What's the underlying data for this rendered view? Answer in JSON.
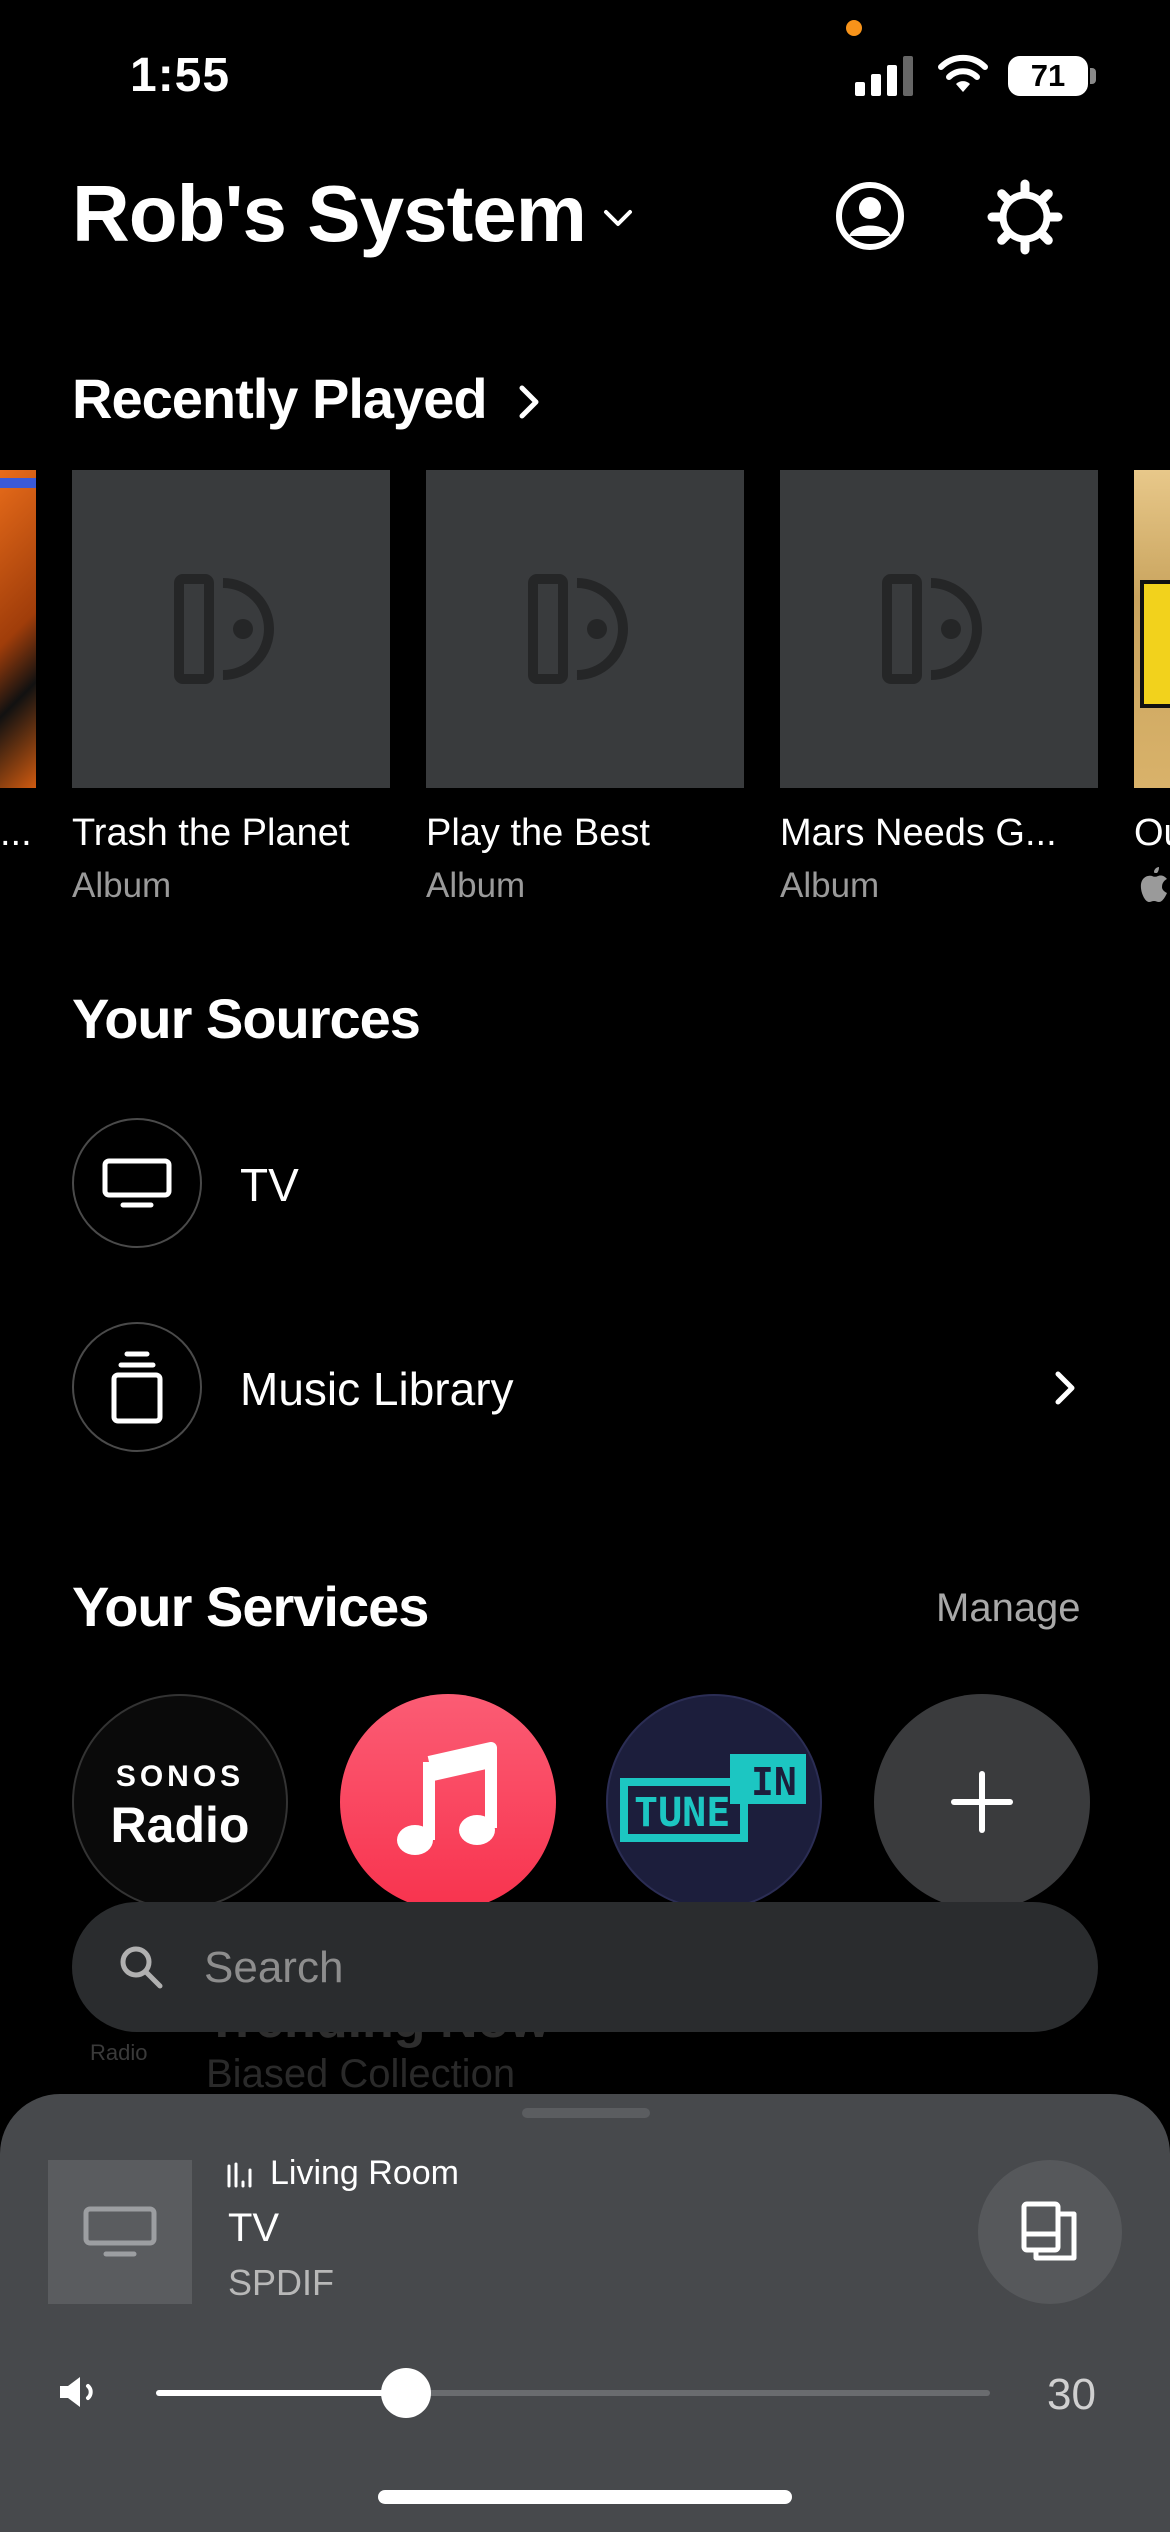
{
  "status_bar": {
    "time": "1:55",
    "battery": "71"
  },
  "header": {
    "title": "Rob's System"
  },
  "recently_played": {
    "title": "Recently Played",
    "left_partial_title": "...",
    "items": [
      {
        "title": "Trash the Planet",
        "subtitle": "Album"
      },
      {
        "title": "Play the Best",
        "subtitle": "Album"
      },
      {
        "title": "Mars Needs G...",
        "subtitle": "Album"
      }
    ],
    "right_partial_title": "Ou"
  },
  "sources": {
    "title": "Your Sources",
    "items": [
      {
        "label": "TV",
        "icon": "tv-icon"
      },
      {
        "label": "Music Library",
        "icon": "music-library-icon"
      }
    ]
  },
  "services": {
    "title": "Your Services",
    "manage_label": "Manage",
    "sonos_radio": {
      "line1": "SONOS",
      "line2": "Radio"
    },
    "tunein": {
      "line1": "TUNE",
      "line2": "IN"
    }
  },
  "behind": {
    "text1": "Trending Now",
    "text2": "Biased Collection",
    "text3": "Radio"
  },
  "search": {
    "placeholder": "Search"
  },
  "now_playing": {
    "room": "Living Room",
    "title": "TV",
    "subtitle": "SPDIF",
    "volume": 30,
    "volume_fraction": 0.3
  }
}
